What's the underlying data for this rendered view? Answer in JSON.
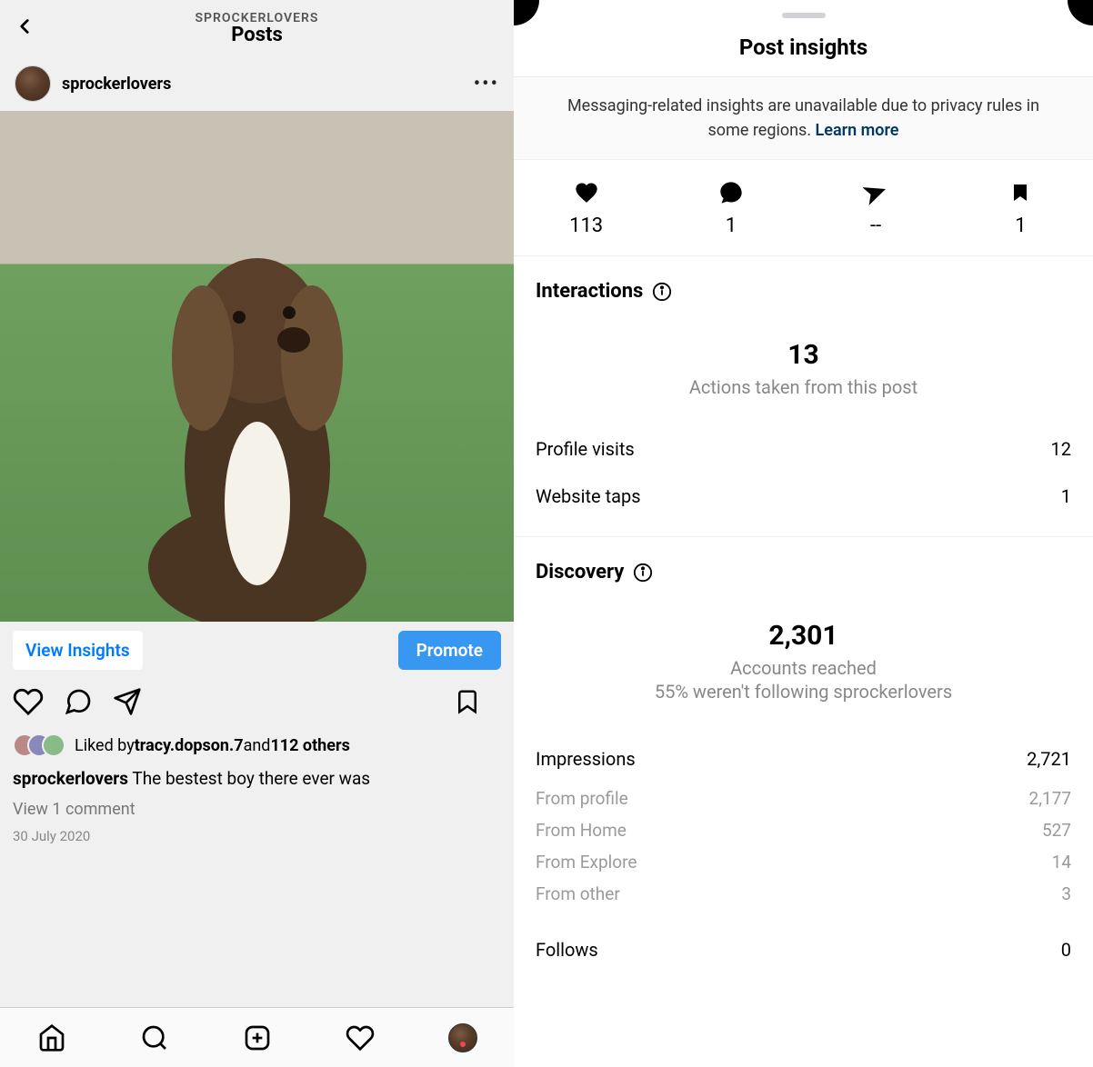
{
  "left": {
    "header_sub": "SPROCKERLOVERS",
    "header_title": "Posts",
    "username": "sprockerlovers",
    "view_insights": "View Insights",
    "promote": "Promote",
    "liked_prefix": "Liked by ",
    "liked_user": "tracy.dopson.7",
    "liked_and": " and ",
    "liked_others": "112 others",
    "caption_user": "sprockerlovers",
    "caption_text": " The bestest boy there ever was",
    "view_comments": "View 1 comment",
    "date": "30 July 2020"
  },
  "right": {
    "title": "Post insights",
    "notice_text": "Messaging-related insights are unavailable due to privacy rules in some regions. ",
    "notice_link": "Learn more",
    "metrics": {
      "likes": "113",
      "comments": "1",
      "shares": "--",
      "saves": "1"
    },
    "interactions": {
      "heading": "Interactions",
      "total": "13",
      "subtitle": "Actions taken from this post",
      "rows": [
        {
          "label": "Profile visits",
          "value": "12"
        },
        {
          "label": "Website taps",
          "value": "1"
        }
      ]
    },
    "discovery": {
      "heading": "Discovery",
      "total": "2,301",
      "subtitle1": "Accounts reached",
      "subtitle2": "55% weren't following sprockerlovers",
      "impressions_label": "Impressions",
      "impressions_value": "2,721",
      "breakdown": [
        {
          "label": "From profile",
          "value": "2,177"
        },
        {
          "label": "From Home",
          "value": "527"
        },
        {
          "label": "From Explore",
          "value": "14"
        },
        {
          "label": "From other",
          "value": "3"
        }
      ],
      "follows_label": "Follows",
      "follows_value": "0"
    }
  }
}
